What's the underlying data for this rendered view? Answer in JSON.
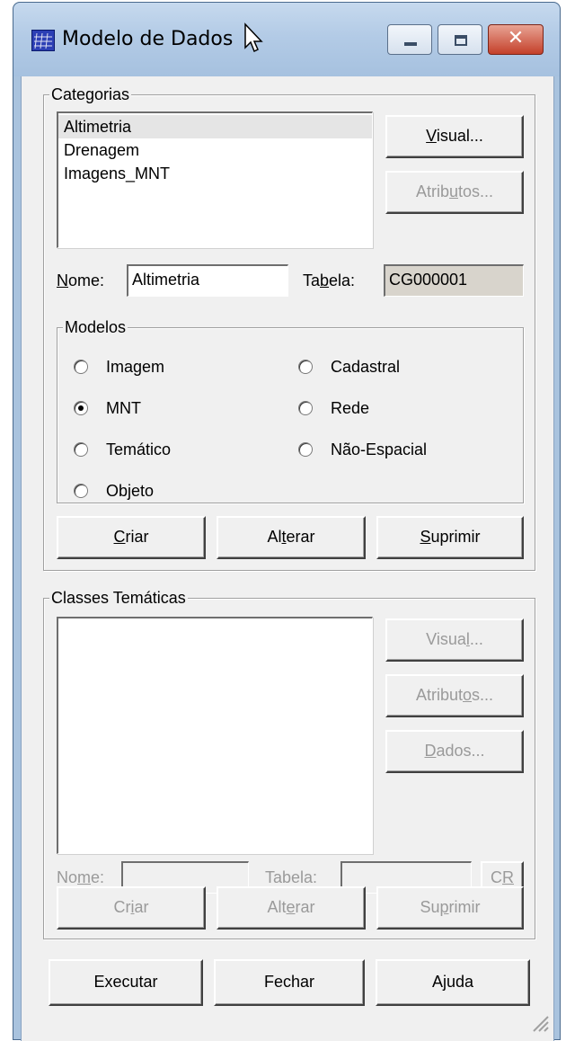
{
  "window": {
    "title": "Modelo de Dados",
    "controls": {
      "minimize": "minimize-icon",
      "maximize": "maximize-icon",
      "close": "✕"
    }
  },
  "categorias": {
    "legend": "Categorias",
    "items": [
      "Altimetria",
      "Drenagem",
      "Imagens_MNT"
    ],
    "selected": "Altimetria",
    "visual_button": {
      "pre": "",
      "key": "V",
      "post": "isual..."
    },
    "atributos_button": {
      "pre": "Atrib",
      "key": "u",
      "post": "tos..."
    },
    "nome_label": {
      "pre": "",
      "key": "N",
      "post": "ome:"
    },
    "nome_value": "Altimetria",
    "tabela_label": {
      "pre": "Ta",
      "key": "b",
      "post": "ela:"
    },
    "tabela_value": "CG000001"
  },
  "modelos": {
    "legend": "Modelos",
    "options": [
      "Imagem",
      "MNT",
      "Temático",
      "Objeto",
      "Cadastral",
      "Rede",
      "Não-Espacial"
    ],
    "selected": "MNT"
  },
  "category_actions": {
    "criar": {
      "pre": "",
      "key": "C",
      "post": "riar"
    },
    "alterar": {
      "pre": "Al",
      "key": "t",
      "post": "erar"
    },
    "suprimir": {
      "pre": "",
      "key": "S",
      "post": "uprimir"
    }
  },
  "classes": {
    "legend": "Classes Temáticas",
    "visual_button": {
      "pre": "Visua",
      "key": "l",
      "post": "..."
    },
    "atributos_button": {
      "pre": "Atribut",
      "key": "o",
      "post": "s..."
    },
    "dados_button": {
      "pre": "",
      "key": "D",
      "post": "ados..."
    },
    "nome_label": {
      "pre": "No",
      "key": "m",
      "post": "e:"
    },
    "nome_value": "",
    "tabela_label": "Tabela:",
    "tabela_value": "",
    "cr_button": {
      "pre": "C",
      "key": "R",
      "post": ""
    },
    "criar": {
      "pre": "Cr",
      "key": "i",
      "post": "ar"
    },
    "alterar": {
      "pre": "Alt",
      "key": "e",
      "post": "rar"
    },
    "suprimir": {
      "pre": "Su",
      "key": "p",
      "post": "rimir"
    }
  },
  "footer": {
    "executar": "Executar",
    "fechar": "Fechar",
    "ajuda": "Ajuda"
  },
  "colors": {
    "titlebar": "#b3cbe6",
    "dialog_face": "#f0f0f0",
    "close_button": "#c4402a",
    "readonly_field": "#d8d4cc",
    "selection": "#e5e5e5"
  }
}
